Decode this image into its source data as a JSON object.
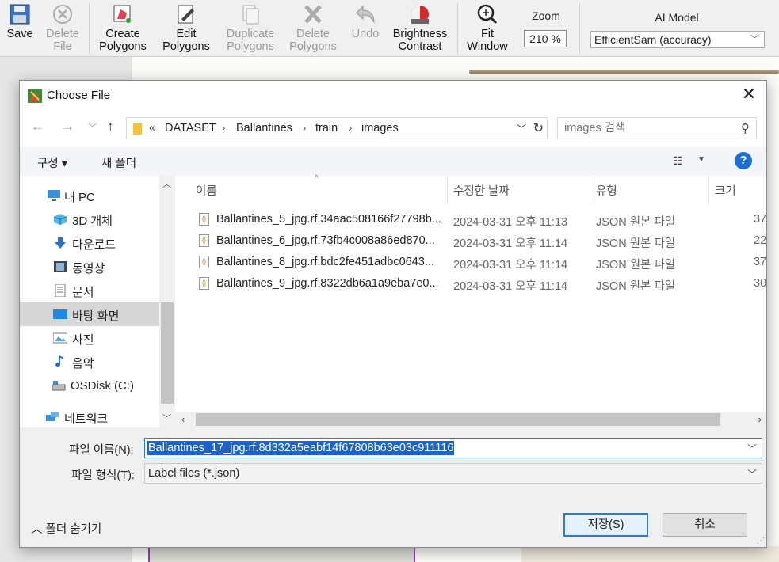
{
  "toolbar": {
    "save": "Save",
    "delete_file": [
      "Delete",
      "File"
    ],
    "create_polygons": [
      "Create",
      "Polygons"
    ],
    "edit_polygons": [
      "Edit",
      "Polygons"
    ],
    "duplicate_polygons": [
      "Duplicate",
      "Polygons"
    ],
    "delete_polygons": [
      "Delete",
      "Polygons"
    ],
    "undo": "Undo",
    "brightness_contrast": [
      "Brightness",
      "Contrast"
    ],
    "fit_window": [
      "Fit",
      "Window"
    ],
    "zoom_label": "Zoom",
    "zoom_value": "210 %",
    "ai_model_label": "AI Model",
    "ai_model_value": "EfficientSam (accuracy)"
  },
  "dialog": {
    "title": "Choose File",
    "breadcrumb": [
      "«",
      "DATASET",
      "Ballantines",
      "train",
      "images"
    ],
    "search_placeholder": "images 검색",
    "organize": "구성 ▾",
    "new_folder": "새 폴더",
    "nav_items": [
      {
        "label": "내 PC",
        "icon": "pc-icon"
      },
      {
        "label": "3D 개체",
        "icon": "cube-icon"
      },
      {
        "label": "다운로드",
        "icon": "download-icon"
      },
      {
        "label": "동영상",
        "icon": "video-icon"
      },
      {
        "label": "문서",
        "icon": "document-icon"
      },
      {
        "label": "바탕 화면",
        "icon": "desktop-icon",
        "selected": true
      },
      {
        "label": "사진",
        "icon": "picture-icon"
      },
      {
        "label": "음악",
        "icon": "music-icon"
      },
      {
        "label": "OSDisk (C:)",
        "icon": "drive-icon"
      },
      {
        "label": "네트워크",
        "icon": "network-icon"
      }
    ],
    "columns": {
      "name": "이름",
      "date": "수정한 날짜",
      "type": "유형",
      "size": "크기"
    },
    "files": [
      {
        "name": "Ballantines_5_jpg.rf.34aac508166f27798b...",
        "date": "2024-03-31 오후 11:13",
        "type": "JSON 원본 파일",
        "size": "37"
      },
      {
        "name": "Ballantines_6_jpg.rf.73fb4c008a86ed870...",
        "date": "2024-03-31 오후 11:14",
        "type": "JSON 원본 파일",
        "size": "22"
      },
      {
        "name": "Ballantines_8_jpg.rf.bdc2fe451adbc0643...",
        "date": "2024-03-31 오후 11:14",
        "type": "JSON 원본 파일",
        "size": "37"
      },
      {
        "name": "Ballantines_9_jpg.rf.8322db6a1a9eba7e0...",
        "date": "2024-03-31 오후 11:14",
        "type": "JSON 원본 파일",
        "size": "30"
      }
    ],
    "filename_label": "파일 이름(N):",
    "filename_value": "Ballantines_17_jpg.rf.8d332a5eabf14f67808b63e03c911116",
    "filetype_label": "파일 형식(T):",
    "filetype_value": "Label files (*.json)",
    "hide_folders": "폴더 숨기기",
    "save_button": "저장(S)",
    "cancel_button": "취소"
  },
  "colors": {
    "accent": "#2b78d6",
    "selection": "#1e62c8",
    "help": "#1b6dd8"
  }
}
